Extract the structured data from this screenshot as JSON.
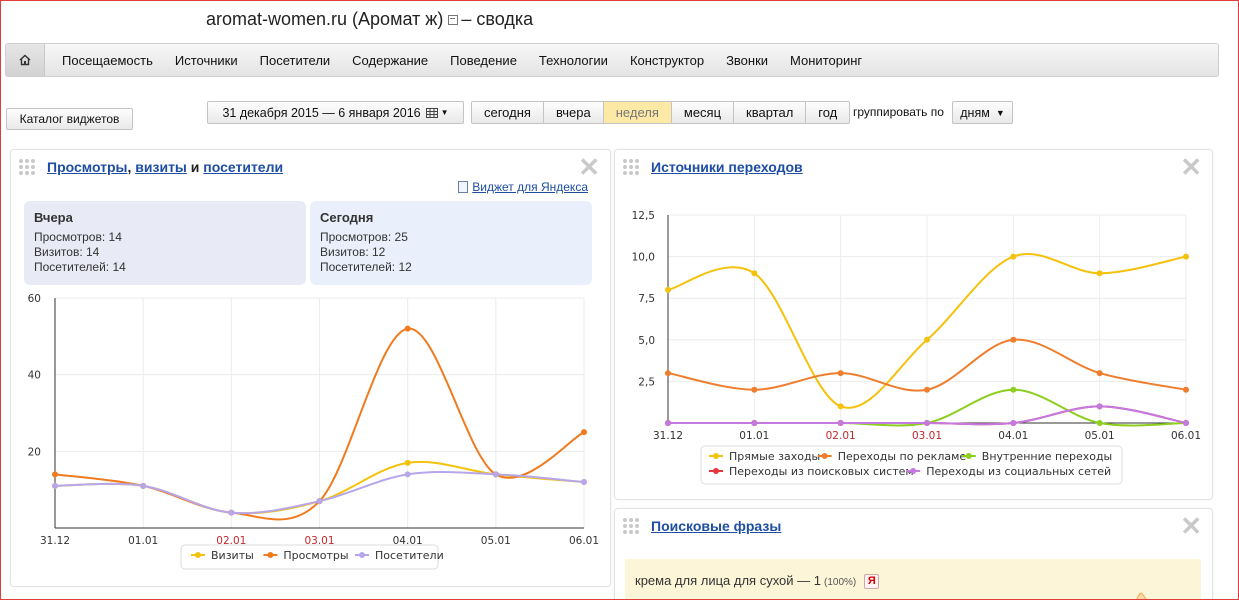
{
  "page": {
    "title_main": "aromat-women.ru (Аромат ж)",
    "title_suffix": "– сводка"
  },
  "nav": {
    "home_icon": "home-icon",
    "items": [
      "Посещаемость",
      "Источники",
      "Посетители",
      "Содержание",
      "Поведение",
      "Технологии",
      "Конструктор",
      "Звонки",
      "Мониторинг"
    ]
  },
  "toolbar": {
    "catalog_label": "Каталог виджетов",
    "date_range": "31 декабря 2015 — 6 января 2016",
    "periods": [
      "сегодня",
      "вчера",
      "неделя",
      "месяц",
      "квартал",
      "год"
    ],
    "active_period": "неделя",
    "group_label": "группировать по",
    "group_value": "дням"
  },
  "widget_traffic": {
    "title_parts": [
      "Просмотры",
      ", ",
      "визиты",
      " и ",
      "посетители"
    ],
    "yandex_link": "Виджет для Яндекса",
    "yesterday": {
      "title": "Вчера",
      "views": "Просмотров: 14",
      "visits": "Визитов: 14",
      "visitors": "Посетителей: 14"
    },
    "today": {
      "title": "Сегодня",
      "views": "Просмотров: 25",
      "visits": "Визитов: 12",
      "visitors": "Посетителей: 12"
    }
  },
  "widget_sources": {
    "title": "Источники переходов"
  },
  "widget_phrases": {
    "title": "Поисковые фразы",
    "phrase": "крема для лица для сухой — 1",
    "percent": "(100%)",
    "badge": "Я"
  },
  "chart_data": [
    {
      "type": "line",
      "x": [
        "31.12",
        "01.01",
        "02.01",
        "03.01",
        "04.01",
        "05.01",
        "06.01"
      ],
      "weekend_x": [
        "02.01",
        "03.01"
      ],
      "ylim": [
        0,
        60
      ],
      "yticks": [
        "20",
        "40",
        "60"
      ],
      "grid": true,
      "legend": "bottom",
      "series": [
        {
          "name": "Визиты",
          "color": "#f4c20d",
          "values": [
            11,
            11,
            4,
            7,
            17,
            14,
            12
          ]
        },
        {
          "name": "Просмотры",
          "color": "#f07b1f",
          "values": [
            14,
            11,
            4,
            7,
            52,
            14,
            25
          ]
        },
        {
          "name": "Посетители",
          "color": "#b7a6ec",
          "values": [
            11,
            11,
            4,
            7,
            14,
            14,
            12
          ]
        }
      ]
    },
    {
      "type": "line",
      "x": [
        "31.12",
        "01.01",
        "02.01",
        "03.01",
        "04.01",
        "05.01",
        "06.01"
      ],
      "weekend_x": [
        "02.01",
        "03.01"
      ],
      "ylim": [
        0,
        12.5
      ],
      "yticks": [
        "2,5",
        "5,0",
        "7,5",
        "10,0",
        "12,5"
      ],
      "grid": true,
      "legend": "bottom",
      "series": [
        {
          "name": "Прямые заходы",
          "color": "#f4c20d",
          "values": [
            8,
            9,
            1,
            5,
            10,
            9,
            10
          ]
        },
        {
          "name": "Переходы по рекламе",
          "color": "#ee7d2d",
          "values": [
            3,
            2,
            3,
            2,
            5,
            3,
            2
          ]
        },
        {
          "name": "Внутренние переходы",
          "color": "#8dce1f",
          "values": [
            0,
            0,
            0,
            0,
            2,
            0,
            0
          ]
        },
        {
          "name": "Переходы из поисковых систем",
          "color": "#e8343a",
          "values": [
            0,
            0,
            0,
            0,
            0,
            1,
            0
          ]
        },
        {
          "name": "Переходы из социальных сетей",
          "color": "#c479e0",
          "values": [
            0,
            0,
            0,
            0,
            0,
            1,
            0
          ]
        }
      ]
    }
  ]
}
